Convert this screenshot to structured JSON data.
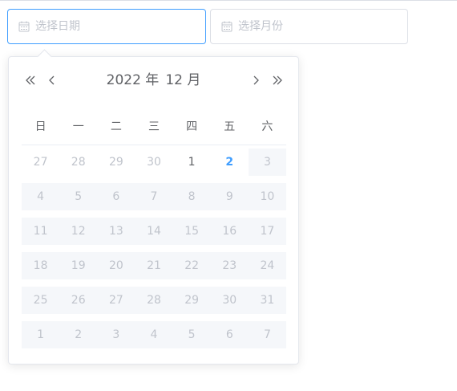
{
  "date_input": {
    "placeholder": "选择日期",
    "icon": "calendar-icon"
  },
  "month_input": {
    "placeholder": "选择月份",
    "icon": "calendar-icon"
  },
  "picker": {
    "year_label": "2022 年",
    "month_label": "12 月",
    "nav_icons": [
      "double-chevron-left-icon",
      "chevron-left-icon",
      "chevron-right-icon",
      "double-chevron-right-icon"
    ],
    "weekdays": [
      "日",
      "一",
      "二",
      "三",
      "四",
      "五",
      "六"
    ],
    "weeks": [
      [
        {
          "day": "27",
          "type": "prev-month"
        },
        {
          "day": "28",
          "type": "prev-month"
        },
        {
          "day": "29",
          "type": "prev-month"
        },
        {
          "day": "30",
          "type": "prev-month"
        },
        {
          "day": "1",
          "type": "available"
        },
        {
          "day": "2",
          "type": "today"
        },
        {
          "day": "3",
          "type": "disabled"
        }
      ],
      [
        {
          "day": "4",
          "type": "disabled"
        },
        {
          "day": "5",
          "type": "disabled"
        },
        {
          "day": "6",
          "type": "disabled"
        },
        {
          "day": "7",
          "type": "disabled"
        },
        {
          "day": "8",
          "type": "disabled"
        },
        {
          "day": "9",
          "type": "disabled"
        },
        {
          "day": "10",
          "type": "disabled"
        }
      ],
      [
        {
          "day": "11",
          "type": "disabled"
        },
        {
          "day": "12",
          "type": "disabled"
        },
        {
          "day": "13",
          "type": "disabled"
        },
        {
          "day": "14",
          "type": "disabled"
        },
        {
          "day": "15",
          "type": "disabled"
        },
        {
          "day": "16",
          "type": "disabled"
        },
        {
          "day": "17",
          "type": "disabled"
        }
      ],
      [
        {
          "day": "18",
          "type": "disabled"
        },
        {
          "day": "19",
          "type": "disabled"
        },
        {
          "day": "20",
          "type": "disabled"
        },
        {
          "day": "21",
          "type": "disabled"
        },
        {
          "day": "22",
          "type": "disabled"
        },
        {
          "day": "23",
          "type": "disabled"
        },
        {
          "day": "24",
          "type": "disabled"
        }
      ],
      [
        {
          "day": "25",
          "type": "disabled"
        },
        {
          "day": "26",
          "type": "disabled"
        },
        {
          "day": "27",
          "type": "disabled"
        },
        {
          "day": "28",
          "type": "disabled"
        },
        {
          "day": "29",
          "type": "disabled"
        },
        {
          "day": "30",
          "type": "disabled"
        },
        {
          "day": "31",
          "type": "disabled"
        }
      ],
      [
        {
          "day": "1",
          "type": "disabled"
        },
        {
          "day": "2",
          "type": "disabled"
        },
        {
          "day": "3",
          "type": "disabled"
        },
        {
          "day": "4",
          "type": "disabled"
        },
        {
          "day": "5",
          "type": "disabled"
        },
        {
          "day": "6",
          "type": "disabled"
        },
        {
          "day": "7",
          "type": "disabled"
        }
      ]
    ]
  },
  "colors": {
    "accent": "#409eff",
    "text": "#606266",
    "muted": "#c0c4cc",
    "disabled_bg": "#f5f7fa",
    "border": "#dcdfe6"
  }
}
